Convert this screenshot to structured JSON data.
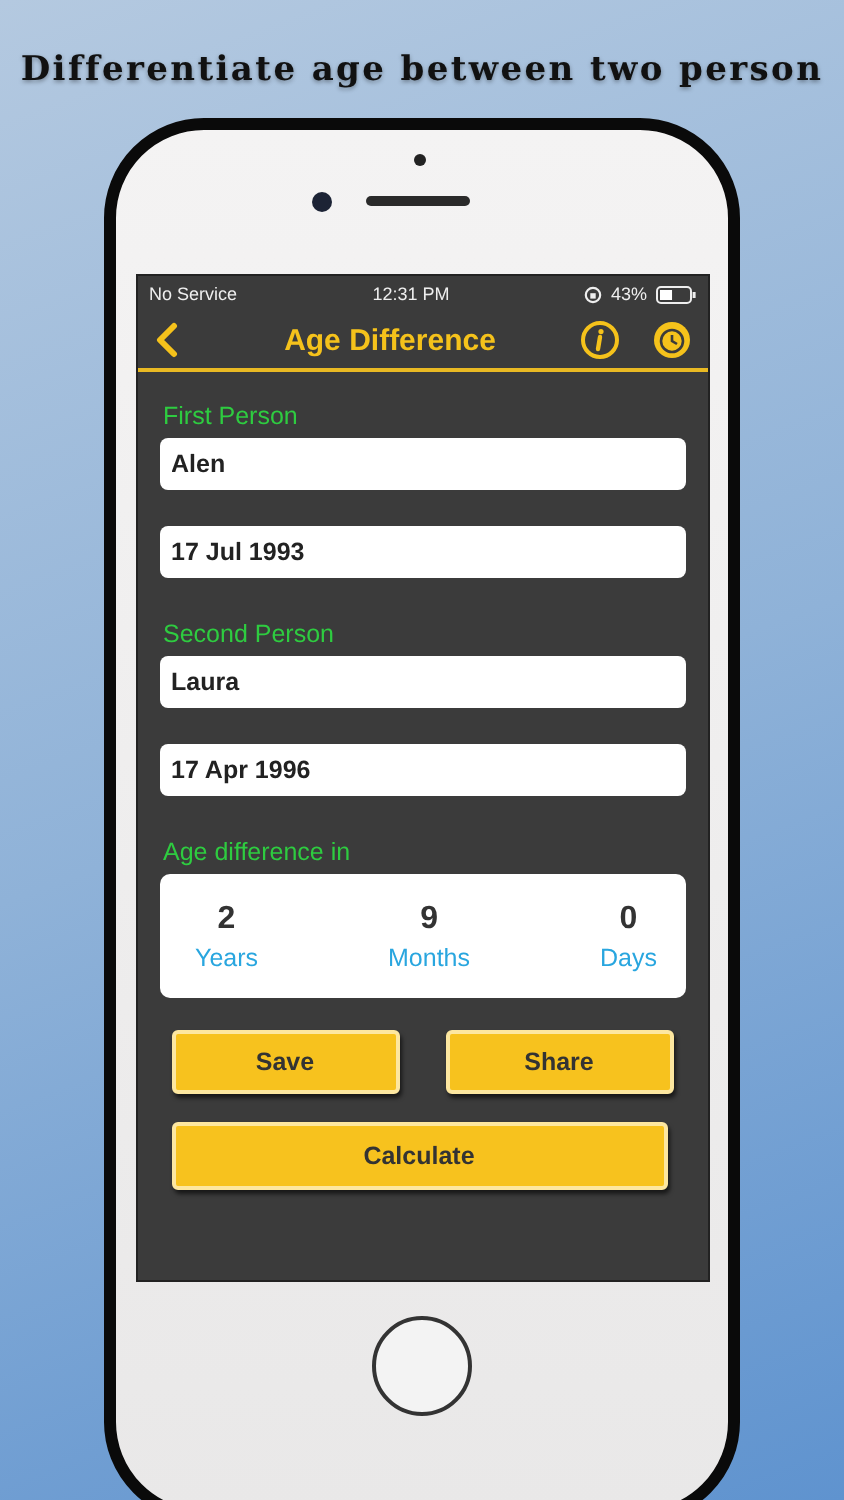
{
  "headline": "Differentiate age between two person",
  "status_bar": {
    "carrier": "No Service",
    "time": "12:31 PM",
    "battery": "43%",
    "battery_meter": {
      "level": 0.43
    }
  },
  "nav": {
    "title": "Age Difference"
  },
  "persons": [
    {
      "label": "First Person",
      "name": "Alen",
      "date": "17 Jul 1993"
    },
    {
      "label": "Second Person",
      "name": "Laura",
      "date": "17 Apr 1996"
    }
  ],
  "result": {
    "label": "Age difference in",
    "parts": [
      {
        "value": "2",
        "unit": "Years"
      },
      {
        "value": "9",
        "unit": "Months"
      },
      {
        "value": "0",
        "unit": "Days"
      }
    ]
  },
  "buttons": [
    {
      "label": "Save",
      "kind": "half"
    },
    {
      "label": "Share",
      "kind": "half"
    },
    {
      "label": "Calculate",
      "kind": "full"
    }
  ]
}
